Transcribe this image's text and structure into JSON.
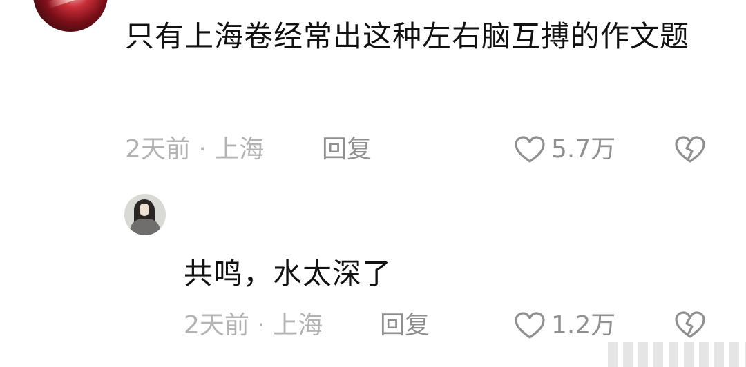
{
  "comments": [
    {
      "text": "只有上海卷经常出这种左右脑互搏的作文题",
      "meta": "2天前 · 上海",
      "reply_label": "回复",
      "likes": "5.7万"
    },
    {
      "text": "共鸣，水太深了",
      "meta": "2天前 · 上海",
      "reply_label": "回复",
      "likes": "1.2万"
    }
  ],
  "icons": {
    "like": "heart-outline-icon",
    "dislike": "broken-heart-icon"
  },
  "colors": {
    "text": "#111111",
    "meta": "#b3b3b3",
    "action": "#8f8f8f"
  }
}
